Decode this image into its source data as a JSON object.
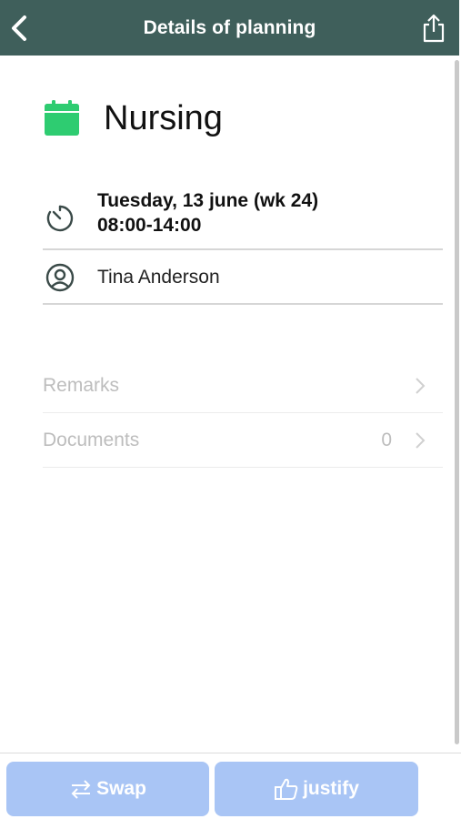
{
  "header": {
    "title": "Details of planning",
    "back_icon": "chevron-left-icon",
    "share_icon": "share-icon",
    "color": "#3f5f5b"
  },
  "planning": {
    "activity": "Nursing",
    "activity_icon": "calendar-icon",
    "activity_color": "#2ecc71",
    "date": "Tuesday, 13 june (wk 24)",
    "time": "08:00-14:00",
    "person": "Tina Anderson"
  },
  "links": {
    "remarks_label": "Remarks",
    "documents_label": "Documents",
    "documents_count": "0"
  },
  "actions": {
    "swap_label": "Swap",
    "justify_label": "justify",
    "button_color": "#a9c5f5"
  }
}
